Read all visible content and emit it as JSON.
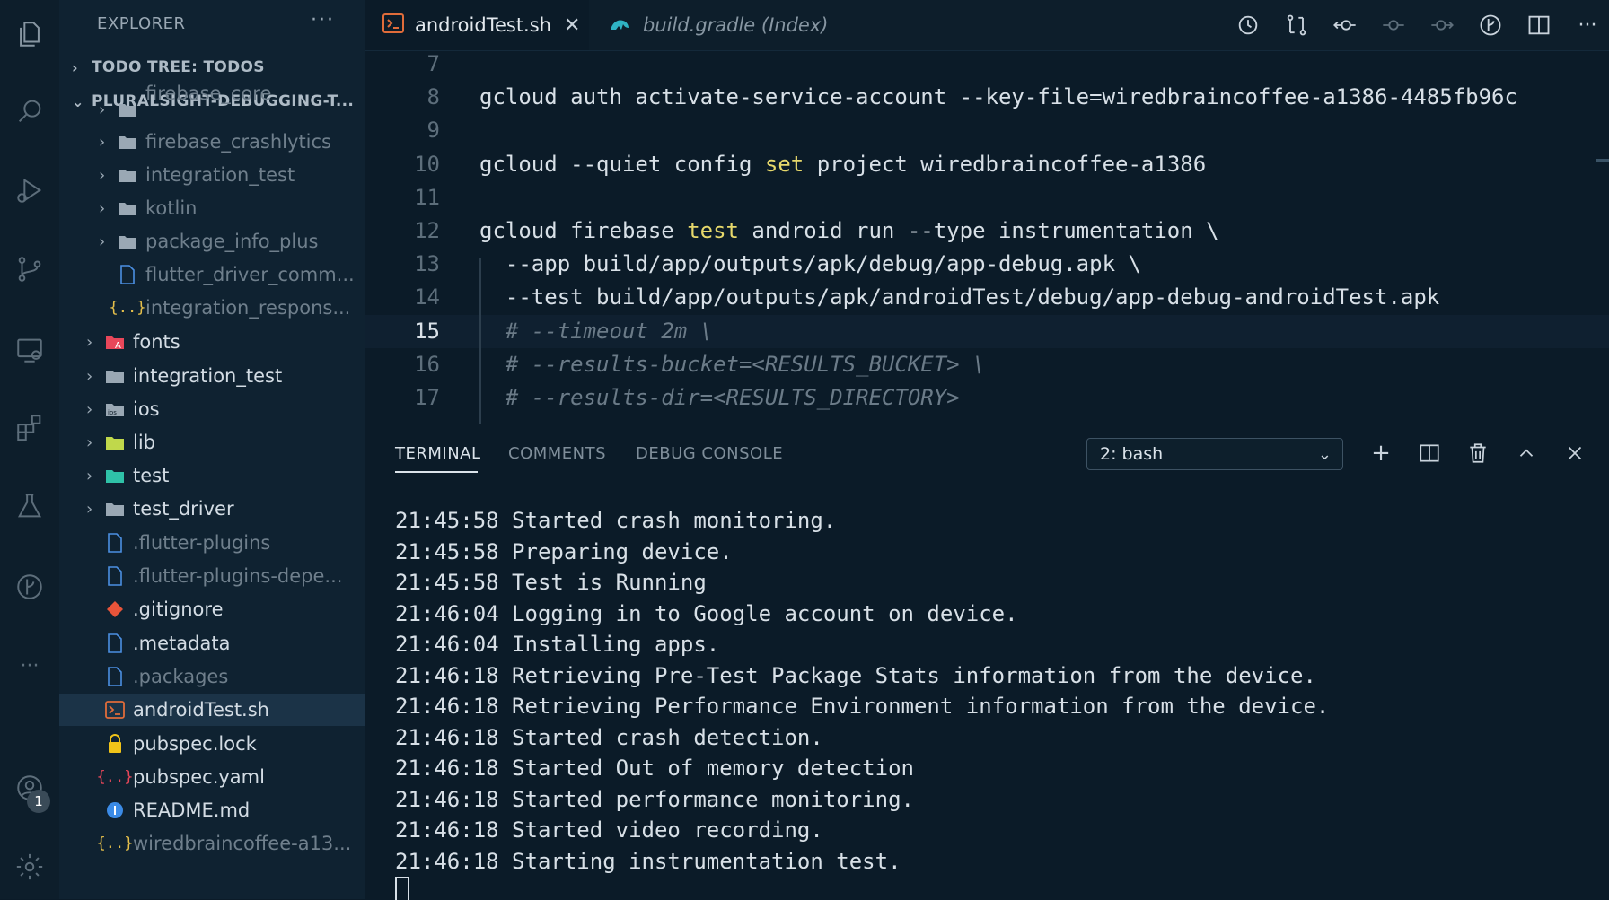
{
  "activity_bar": {
    "icons": [
      "explorer-icon",
      "search-icon",
      "run-debug-icon",
      "source-control-icon",
      "remote-explorer-icon",
      "extensions-icon",
      "testing-icon",
      "gitlens-icon",
      "more-icon",
      "accounts-icon",
      "settings-gear-icon"
    ],
    "accounts_badge": "1"
  },
  "sidebar": {
    "title": "EXPLORER",
    "more": "···",
    "sections": {
      "todo": "TODO TREE: TODOS",
      "project": "PLURALSIGHT-DEBUGGING-T..."
    },
    "tree": [
      {
        "label": "firebase_core",
        "icon": "folder-icon",
        "chevron": "›"
      },
      {
        "label": "firebase_crashlytics",
        "icon": "folder-icon",
        "chevron": "›"
      },
      {
        "label": "integration_test",
        "icon": "folder-icon",
        "chevron": "›"
      },
      {
        "label": "kotlin",
        "icon": "folder-icon",
        "chevron": "›"
      },
      {
        "label": "package_info_plus",
        "icon": "folder-icon",
        "chevron": "›"
      },
      {
        "label": "flutter_driver_comm...",
        "icon": "file-icon"
      },
      {
        "label": "integration_respons...",
        "icon": "json-icon"
      },
      {
        "label": "fonts",
        "icon": "folder-fonts-icon",
        "chevron": "›"
      },
      {
        "label": "integration_test",
        "icon": "folder-icon",
        "chevron": "›"
      },
      {
        "label": "ios",
        "icon": "folder-ios-icon",
        "chevron": "›"
      },
      {
        "label": "lib",
        "icon": "folder-lib-icon",
        "chevron": "›"
      },
      {
        "label": "test",
        "icon": "folder-test-icon",
        "chevron": "›"
      },
      {
        "label": "test_driver",
        "icon": "folder-icon",
        "chevron": "›"
      },
      {
        "label": ".flutter-plugins",
        "icon": "file-icon"
      },
      {
        "label": ".flutter-plugins-depe...",
        "icon": "file-icon"
      },
      {
        "label": ".gitignore",
        "icon": "git-icon"
      },
      {
        "label": ".metadata",
        "icon": "file-icon"
      },
      {
        "label": ".packages",
        "icon": "file-icon"
      },
      {
        "label": "androidTest.sh",
        "icon": "shell-icon"
      },
      {
        "label": "pubspec.lock",
        "icon": "lock-icon"
      },
      {
        "label": "pubspec.yaml",
        "icon": "yaml-icon"
      },
      {
        "label": "README.md",
        "icon": "info-icon"
      },
      {
        "label": "wiredbraincoffee-a13...",
        "icon": "json-icon"
      }
    ]
  },
  "tabs": [
    {
      "label": "androidTest.sh",
      "close": "✕"
    },
    {
      "label": "build.gradle (Index)"
    }
  ],
  "editor": {
    "lines": [
      {
        "n": "7",
        "parts": []
      },
      {
        "n": "8",
        "parts": [
          {
            "t": "gcloud auth activate-service-account --key-file=wiredbraincoffee-a1386-4485fb96c",
            "c": "plain"
          }
        ]
      },
      {
        "n": "9",
        "parts": []
      },
      {
        "n": "10",
        "parts": [
          {
            "t": "gcloud --quiet config ",
            "c": "plain"
          },
          {
            "t": "set",
            "c": "kw"
          },
          {
            "t": " project wiredbraincoffee-a1386",
            "c": "plain"
          }
        ]
      },
      {
        "n": "11",
        "parts": []
      },
      {
        "n": "12",
        "parts": [
          {
            "t": "gcloud firebase ",
            "c": "plain"
          },
          {
            "t": "test",
            "c": "kw"
          },
          {
            "t": " android run --type instrumentation \\",
            "c": "plain"
          }
        ]
      },
      {
        "n": "13",
        "parts": [
          {
            "t": "  --app build/app/outputs/apk/debug/app-debug.apk \\",
            "c": "plain"
          }
        ]
      },
      {
        "n": "14",
        "parts": [
          {
            "t": "  --test build/app/outputs/apk/androidTest/debug/app-debug-androidTest.apk",
            "c": "plain"
          }
        ]
      },
      {
        "n": "15",
        "parts": [
          {
            "t": "  # --timeout 2m \\",
            "c": "cm"
          }
        ]
      },
      {
        "n": "16",
        "parts": [
          {
            "t": "  # --results-bucket=<RESULTS_BUCKET> \\",
            "c": "cm"
          }
        ]
      },
      {
        "n": "17",
        "parts": [
          {
            "t": "  # --results-dir=<RESULTS_DIRECTORY>",
            "c": "cm"
          }
        ]
      }
    ]
  },
  "panel": {
    "tabs": [
      "TERMINAL",
      "COMMENTS",
      "DEBUG CONSOLE"
    ],
    "terminal_select": "2: bash",
    "terminal_lines": [
      "21:45:58 Started crash monitoring.",
      "21:45:58 Preparing device.",
      "21:45:58 Test is Running",
      "21:46:04 Logging in to Google account on device.",
      "21:46:04 Installing apps.",
      "21:46:18 Retrieving Pre-Test Package Stats information from the device.",
      "21:46:18 Retrieving Performance Environment information from the device.",
      "21:46:18 Started crash detection.",
      "21:46:18 Started Out of memory detection",
      "21:46:18 Started performance monitoring.",
      "21:46:18 Started video recording.",
      "21:46:18 Starting instrumentation test."
    ]
  },
  "colors": {
    "background": "#0b1b28",
    "sidebar": "#0f2231",
    "keyword": "#e6d86b",
    "comment": "#6b7b88",
    "selected_row": "#1b3347"
  }
}
